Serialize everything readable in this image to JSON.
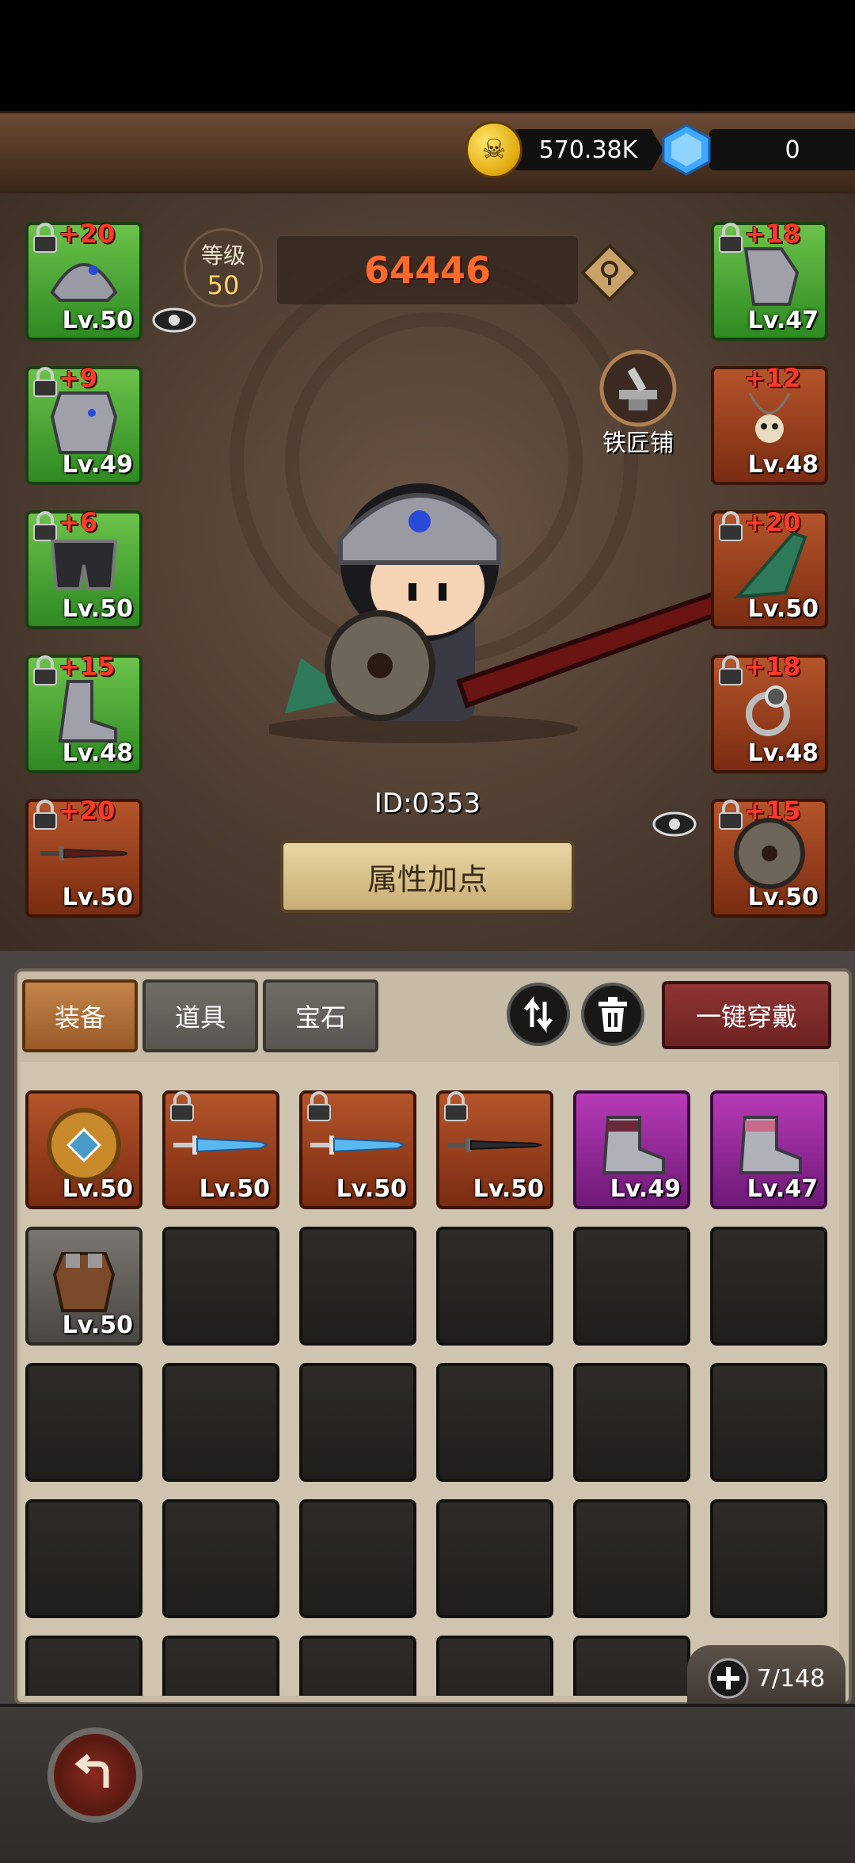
{
  "currency": {
    "gold": "570.38K",
    "gems": "0",
    "gold_icon": "skull-coin-icon",
    "gem_icon": "blue-diamond-icon"
  },
  "character": {
    "level_label": "等级",
    "level_value": "50",
    "power": "64446",
    "id_text": "ID:0353",
    "blacksmith_label": "铁匠铺",
    "attr_button": "属性加点"
  },
  "left_slots": [
    {
      "plus": "+20",
      "level": "Lv.50",
      "rarity": "green",
      "icon": "helmet-icon"
    },
    {
      "plus": "+9",
      "level": "Lv.49",
      "rarity": "green",
      "icon": "chest-armor-icon"
    },
    {
      "plus": "+6",
      "level": "Lv.50",
      "rarity": "green",
      "icon": "leg-armor-icon"
    },
    {
      "plus": "+15",
      "level": "Lv.48",
      "rarity": "green",
      "icon": "boots-icon"
    },
    {
      "plus": "+20",
      "level": "Lv.50",
      "rarity": "orange",
      "icon": "sword-icon"
    }
  ],
  "right_slots": [
    {
      "plus": "+18",
      "level": "Lv.47",
      "rarity": "green",
      "icon": "gauntlet-icon"
    },
    {
      "plus": "+12",
      "level": "Lv.48",
      "rarity": "orange",
      "icon": "skull-necklace-icon"
    },
    {
      "plus": "+20",
      "level": "Lv.50",
      "rarity": "orange",
      "icon": "cape-icon"
    },
    {
      "plus": "+18",
      "level": "Lv.48",
      "rarity": "orange",
      "icon": "ring-icon"
    },
    {
      "plus": "+15",
      "level": "Lv.50",
      "rarity": "orange",
      "icon": "shield-icon"
    }
  ],
  "tabs": [
    "装备",
    "道具",
    "宝石"
  ],
  "equip_all": "一键穿戴",
  "inventory_items": [
    {
      "level": "Lv.50",
      "rarity": "orange",
      "icon": "round-shield-icon",
      "locked": false
    },
    {
      "level": "Lv.50",
      "rarity": "orange",
      "icon": "ice-sword-icon",
      "locked": true
    },
    {
      "level": "Lv.50",
      "rarity": "orange",
      "icon": "ice-sword-icon",
      "locked": true
    },
    {
      "level": "Lv.50",
      "rarity": "orange",
      "icon": "dark-sword-icon",
      "locked": true
    },
    {
      "level": "Lv.49",
      "rarity": "purple",
      "icon": "boots-icon",
      "locked": false
    },
    {
      "level": "Lv.47",
      "rarity": "purple",
      "icon": "boots-icon",
      "locked": false
    },
    {
      "level": "Lv.50",
      "rarity": "grey",
      "icon": "leather-armor-icon",
      "locked": false
    }
  ],
  "capacity": "7/148",
  "colors": {
    "power": "#ff6a2a",
    "plus": "#ff3a2a",
    "green_slot": "#4aa836",
    "orange_slot": "#9a3e1c",
    "purple_slot": "#9a2aa0"
  }
}
